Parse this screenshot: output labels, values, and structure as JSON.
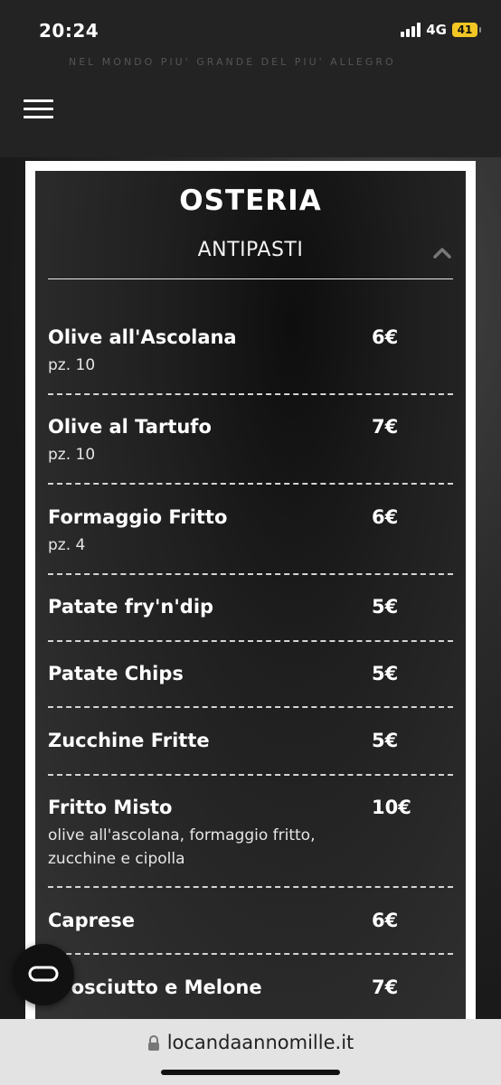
{
  "status_bar": {
    "time": "20:24",
    "network": "4G",
    "battery": "41"
  },
  "header": {
    "faint_text": "NEL MONDO PIU' GRANDE DEL PIU' ALLEGRO",
    "menu_icon": "hamburger-icon"
  },
  "menu": {
    "title": "OSTERIA",
    "section": "ANTIPASTI",
    "items": [
      {
        "name": "Olive all'Ascolana",
        "price": "6€",
        "desc": "pz. 10"
      },
      {
        "name": "Olive al Tartufo",
        "price": "7€",
        "desc": "pz. 10"
      },
      {
        "name": "Formaggio Fritto",
        "price": "6€",
        "desc": "pz. 4"
      },
      {
        "name": "Patate fry'n'dip",
        "price": "5€",
        "desc": ""
      },
      {
        "name": "Patate Chips",
        "price": "5€",
        "desc": ""
      },
      {
        "name": "Zucchine Fritte",
        "price": "5€",
        "desc": ""
      },
      {
        "name": "Fritto Misto",
        "price": "10€",
        "desc": "olive all'ascolana, formaggio fritto, zucchine e cipolla"
      },
      {
        "name": "Caprese",
        "price": "6€",
        "desc": ""
      },
      {
        "name": "Prosciutto e Melone",
        "price": "7€",
        "desc": ""
      }
    ]
  },
  "browser": {
    "url": "locandaannomille.it"
  },
  "icons": {
    "lock": "lock-icon",
    "chevron": "chevron-up-icon",
    "float": "link-icon"
  },
  "colors": {
    "background": "#1c1c1c",
    "card_border": "#ffffff",
    "battery": "#f3c623"
  }
}
